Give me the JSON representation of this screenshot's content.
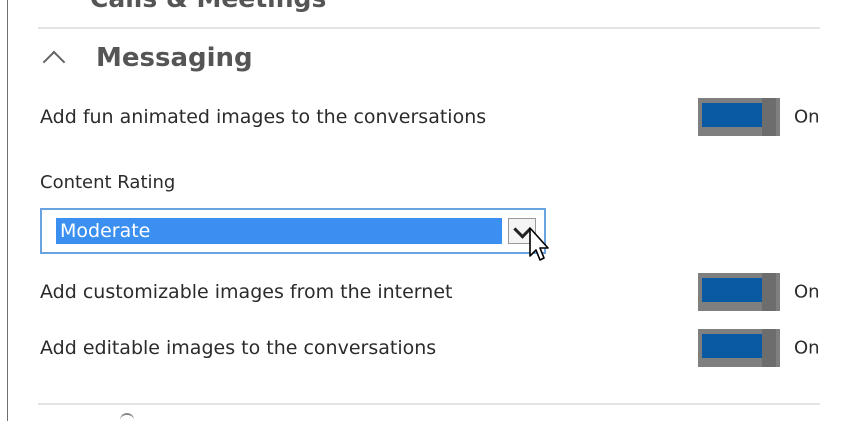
{
  "sections": {
    "previous_title": "Calls & Meetings",
    "current_title": "Messaging"
  },
  "settings": [
    {
      "label": "Add fun animated images to the conversations",
      "state": "On"
    },
    {
      "label": "Add customizable images from the internet",
      "state": "On"
    },
    {
      "label": "Add editable images to the conversations",
      "state": "On"
    }
  ],
  "content_rating": {
    "label": "Content Rating",
    "selected": "Moderate"
  },
  "colors": {
    "toggle_on": "#0a5aa3",
    "toggle_track": "#7f7f7f",
    "selection_highlight": "#3a8ff0",
    "select_border": "#6aa4e0"
  },
  "icons": {
    "collapse": "chevron-up-icon",
    "dropdown": "chevron-down-icon",
    "pointer": "mouse-cursor-icon"
  }
}
